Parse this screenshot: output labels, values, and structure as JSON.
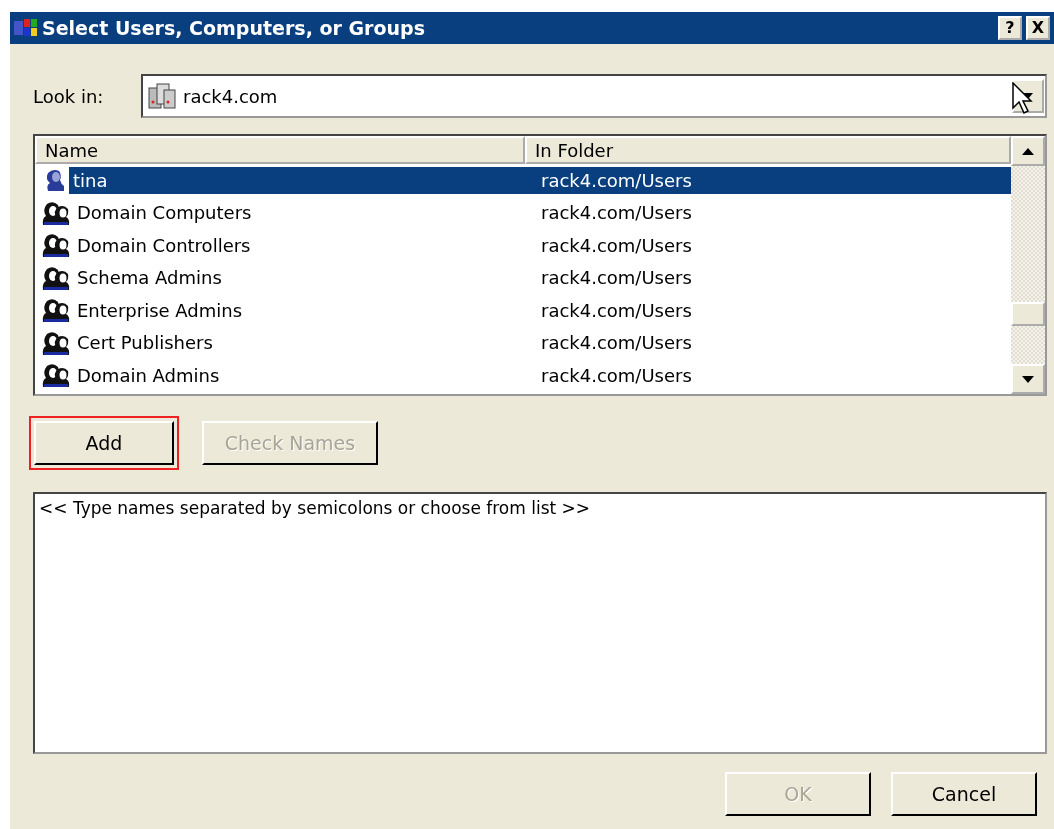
{
  "window": {
    "title": "Select Users, Computers, or Groups",
    "buttons": [
      "?",
      "X"
    ]
  },
  "look_in": {
    "label": "Look in:",
    "value": "rack4.com"
  },
  "list": {
    "columns": [
      "Name",
      "In Folder"
    ],
    "rows": [
      {
        "kind": "user",
        "name": "tina",
        "folder": "rack4.com/Users",
        "selected": true
      },
      {
        "kind": "group",
        "name": "Domain Computers",
        "folder": "rack4.com/Users",
        "selected": false
      },
      {
        "kind": "group",
        "name": "Domain Controllers",
        "folder": "rack4.com/Users",
        "selected": false
      },
      {
        "kind": "group",
        "name": "Schema Admins",
        "folder": "rack4.com/Users",
        "selected": false
      },
      {
        "kind": "group",
        "name": "Enterprise Admins",
        "folder": "rack4.com/Users",
        "selected": false
      },
      {
        "kind": "group",
        "name": "Cert Publishers",
        "folder": "rack4.com/Users",
        "selected": false
      },
      {
        "kind": "group",
        "name": "Domain Admins",
        "folder": "rack4.com/Users",
        "selected": false
      }
    ]
  },
  "actions": [
    {
      "label": "Add",
      "disabled": false,
      "highlighted": true
    },
    {
      "label": "Check Names",
      "disabled": true,
      "highlighted": false
    }
  ],
  "names_box": {
    "value": "<< Type names separated by semicolons or choose from list >>"
  },
  "footer_buttons": [
    {
      "label": "OK",
      "disabled": true
    },
    {
      "label": "Cancel",
      "disabled": false
    }
  ]
}
